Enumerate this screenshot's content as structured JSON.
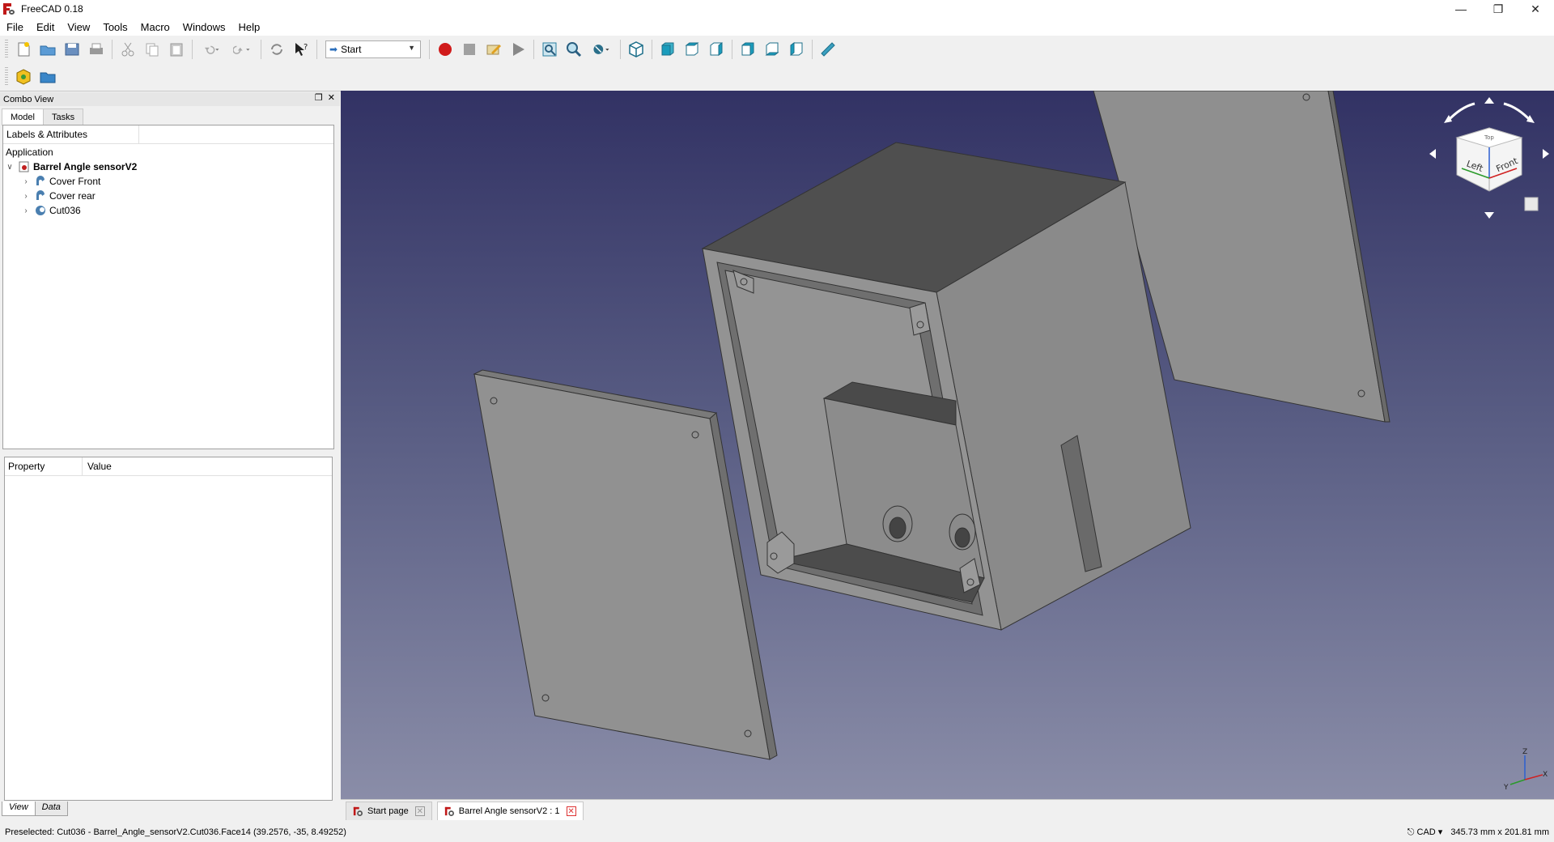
{
  "window": {
    "title": "FreeCAD 0.18"
  },
  "menu": [
    "File",
    "Edit",
    "View",
    "Tools",
    "Macro",
    "Windows",
    "Help"
  ],
  "toolbar": {
    "workbench": "Start"
  },
  "combo_view": {
    "title": "Combo View",
    "tabs": [
      "Model",
      "Tasks"
    ],
    "tree_header": "Labels & Attributes",
    "tree": {
      "root": "Application",
      "document": "Barrel Angle sensorV2",
      "children": [
        "Cover Front",
        "Cover rear",
        "Cut036"
      ]
    },
    "property_columns": [
      "Property",
      "Value"
    ],
    "bottom_tabs": [
      "View",
      "Data"
    ]
  },
  "navcube": {
    "faces": [
      "Left",
      "Front",
      "Top"
    ]
  },
  "axis": {
    "z": "Z",
    "x": "X",
    "y": "Y"
  },
  "doc_tabs": [
    "Start page",
    "Barrel Angle sensorV2 : 1"
  ],
  "status": {
    "preselected": "Preselected: Cut036 - Barrel_Angle_sensorV2.Cut036.Face14 (39.2576, -35, 8.49252)",
    "nav_style": "CAD",
    "dimensions": "345.73 mm x 201.81 mm"
  },
  "colors": {
    "accent_red": "#c01818",
    "viewport_top": "#323264",
    "viewport_bottom": "#8a8da8"
  }
}
